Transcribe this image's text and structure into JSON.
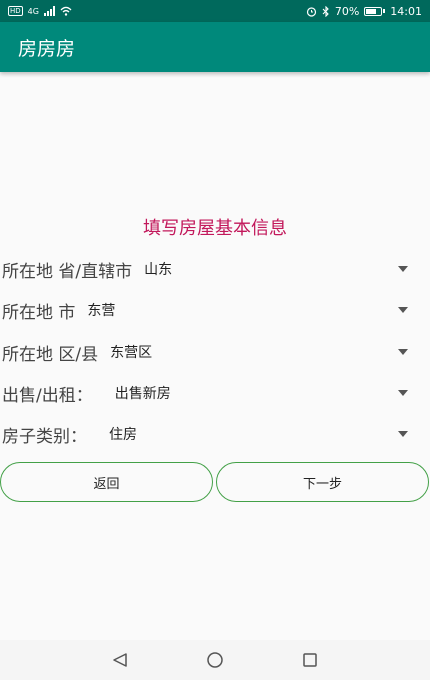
{
  "status_bar": {
    "carrier_tag": "HD",
    "network": "4G",
    "battery": "70%",
    "time": "14:01",
    "battery_level": 0.7
  },
  "app": {
    "title": "房房房"
  },
  "form": {
    "title": "填写房屋基本信息",
    "fields": [
      {
        "label": "所在地 省/直辖市",
        "value": "山东"
      },
      {
        "label": "所在地 市",
        "value": "东营"
      },
      {
        "label": "所在地 区/县",
        "value": "东营区"
      },
      {
        "label": "出售/出租：",
        "value": "出售新房"
      },
      {
        "label": "房子类别：",
        "value": "住房"
      }
    ]
  },
  "buttons": {
    "back": "返回",
    "next": "下一步"
  },
  "colors": {
    "status_bar": "#00695c",
    "app_bar": "#00897b",
    "title": "#c2185b",
    "button_border": "#43a047"
  },
  "icons": [
    "wifi-icon",
    "alarm-icon",
    "bluetooth-icon",
    "battery-icon",
    "back-icon",
    "home-icon",
    "recents-icon"
  ]
}
